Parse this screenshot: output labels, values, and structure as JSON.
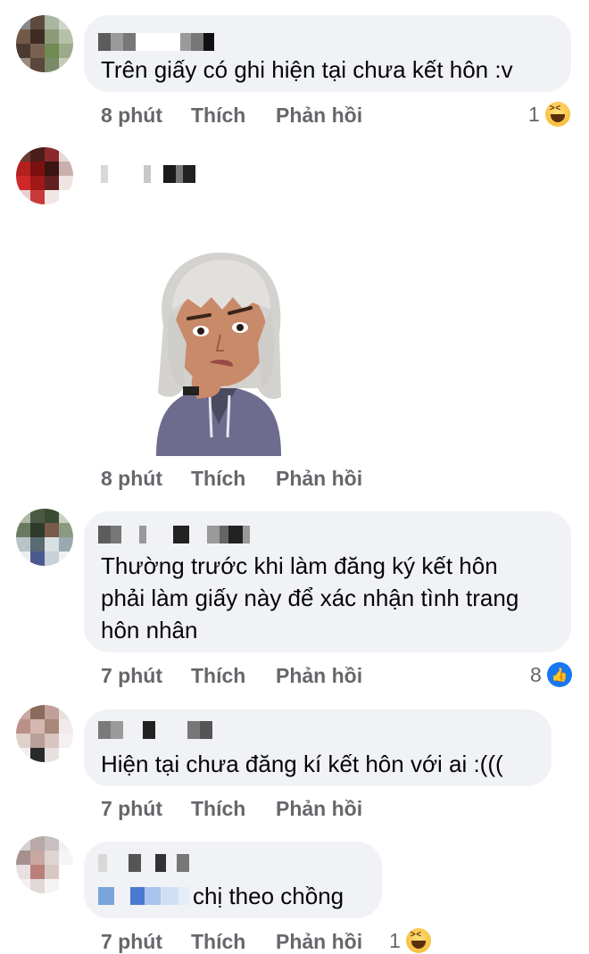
{
  "comments": [
    {
      "text_lines": [
        "Trên giấy có ghi hiện tại chưa kết hôn :v"
      ],
      "time": "8 phút",
      "like": "Thích",
      "reply": "Phản hồi",
      "reaction_count": "1",
      "reaction_icon": "haha-icon"
    },
    {
      "sticker": "thinking-avatar-sticker",
      "time": "8 phút",
      "like": "Thích",
      "reply": "Phản hồi"
    },
    {
      "text_lines": [
        "Thường trước khi làm đăng ký kết hôn",
        "phải làm giấy này để xác nhận tình trang",
        "hôn nhân"
      ],
      "time": "7 phút",
      "like": "Thích",
      "reply": "Phản hồi",
      "reaction_count": "8",
      "reaction_icon": "like-icon"
    },
    {
      "text_lines": [
        "Hiện tại chưa đăng kí kết hôn với ai :((("
      ],
      "time": "7 phút",
      "like": "Thích",
      "reply": "Phản hồi"
    },
    {
      "text_lines": [
        "chị theo chồng"
      ],
      "time": "7 phút",
      "like": "Thích",
      "reply": "Phản hồi",
      "reaction_count": "1",
      "reaction_icon": "haha-icon"
    }
  ],
  "colors": {
    "bubble": "#f0f2f5",
    "meta": "#65676b",
    "text": "#050505",
    "like_blue": "#1877f2"
  }
}
